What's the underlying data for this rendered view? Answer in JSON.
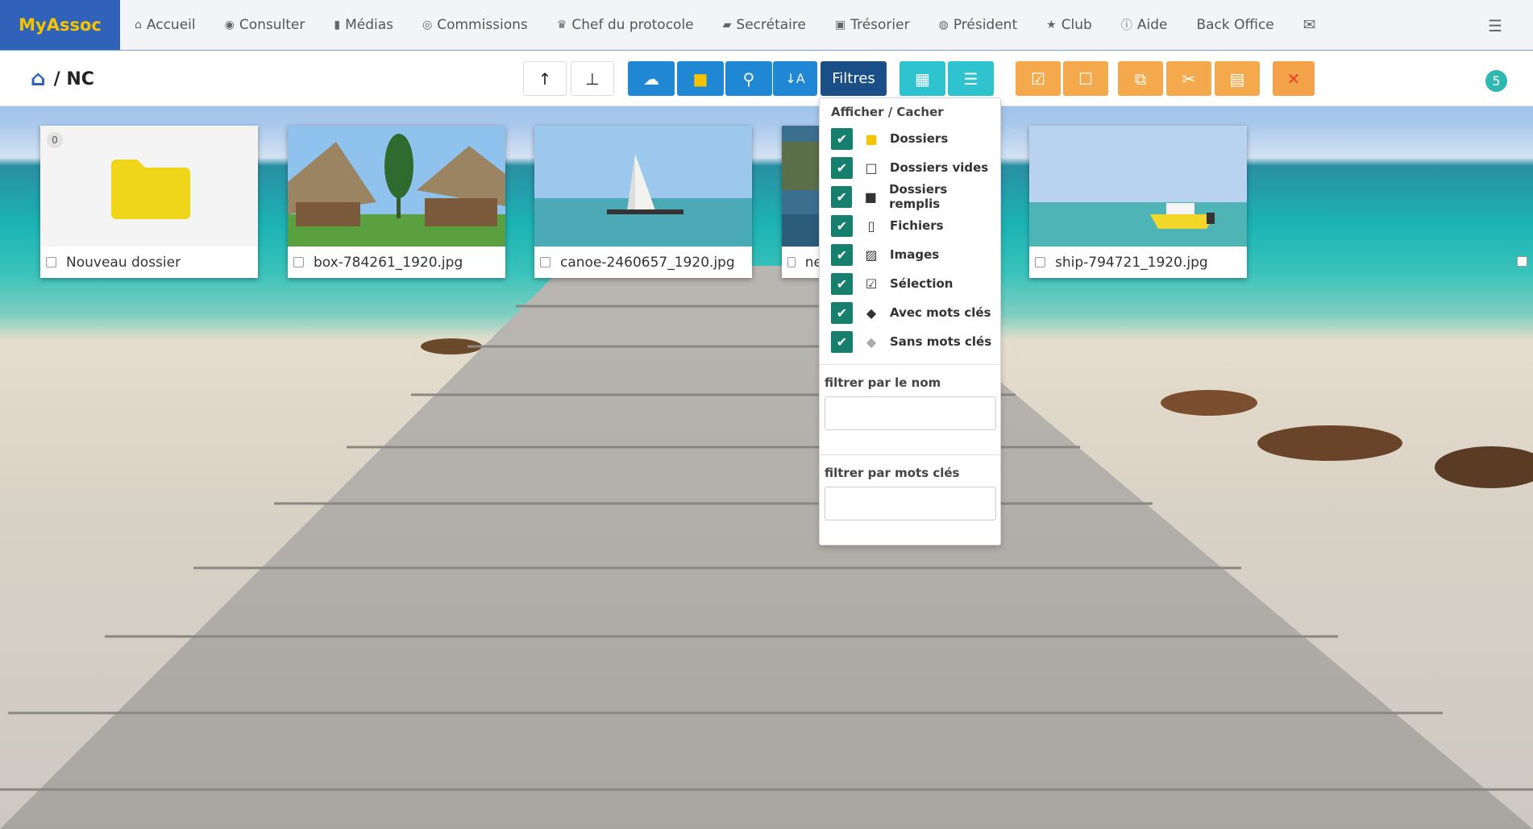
{
  "app": {
    "brand": "MyAssoc"
  },
  "nav": {
    "items": [
      {
        "label": "Accueil",
        "icon": "home-icon",
        "glyph": "⌂"
      },
      {
        "label": "Consulter",
        "icon": "eye-icon",
        "glyph": "◉"
      },
      {
        "label": "Médias",
        "icon": "file-icon",
        "glyph": "▮"
      },
      {
        "label": "Commissions",
        "icon": "user-circle-icon",
        "glyph": "◎"
      },
      {
        "label": "Chef du protocole",
        "icon": "trophy-icon",
        "glyph": "♛"
      },
      {
        "label": "Secrétaire",
        "icon": "book-icon",
        "glyph": "▰"
      },
      {
        "label": "Trésorier",
        "icon": "money-icon",
        "glyph": "▣"
      },
      {
        "label": "Président",
        "icon": "globe-icon",
        "glyph": "◍"
      },
      {
        "label": "Club",
        "icon": "star-icon",
        "glyph": "★"
      },
      {
        "label": "Aide",
        "icon": "info-icon",
        "glyph": "ⓘ"
      },
      {
        "label": "Back Office",
        "icon": "",
        "glyph": ""
      },
      {
        "label": "",
        "icon": "envelope-icon",
        "glyph": "✉"
      }
    ],
    "right_icon": "server-icon",
    "right_glyph": "☰"
  },
  "breadcrumb": {
    "path": "/ NC"
  },
  "toolbar": {
    "filters_label": "Filtres",
    "notification_count": "5"
  },
  "files": [
    {
      "name": "Nouveau dossier",
      "type": "folder",
      "count": "0"
    },
    {
      "name": "box-784261_1920.jpg",
      "type": "image"
    },
    {
      "name": "canoe-2460657_1920.jpg",
      "type": "image"
    },
    {
      "name": "ne",
      "type": "image"
    },
    {
      "name": "ship-794721_1920.jpg",
      "type": "image"
    }
  ],
  "filters_menu": {
    "title": "Afficher / Cacher",
    "options": [
      {
        "label": "Dossiers",
        "checked": true,
        "icon": "folder-yellow-icon"
      },
      {
        "label": "Dossiers vides",
        "checked": true,
        "icon": "folder-open-icon"
      },
      {
        "label": "Dossiers remplis",
        "checked": true,
        "icon": "folder-filled-icon"
      },
      {
        "label": "Fichiers",
        "checked": true,
        "icon": "file-outline-icon"
      },
      {
        "label": "Images",
        "checked": true,
        "icon": "image-icon"
      },
      {
        "label": "Sélection",
        "checked": true,
        "icon": "check-square-icon"
      },
      {
        "label": "Avec mots clés",
        "checked": true,
        "icon": "tag-dark-icon"
      },
      {
        "label": "Sans mots clés",
        "checked": true,
        "icon": "tag-grey-icon"
      }
    ],
    "name_filter_label": "filtrer par le nom",
    "keyword_filter_label": "filtrer par mots clés"
  },
  "colors": {
    "brand_bg": "#2f62b8",
    "brand_text": "#f5c400",
    "primary": "#1f87d4",
    "filters": "#1a4e86",
    "teal": "#2fc3cf",
    "orange": "#f5a94d",
    "check": "#177f6e"
  }
}
